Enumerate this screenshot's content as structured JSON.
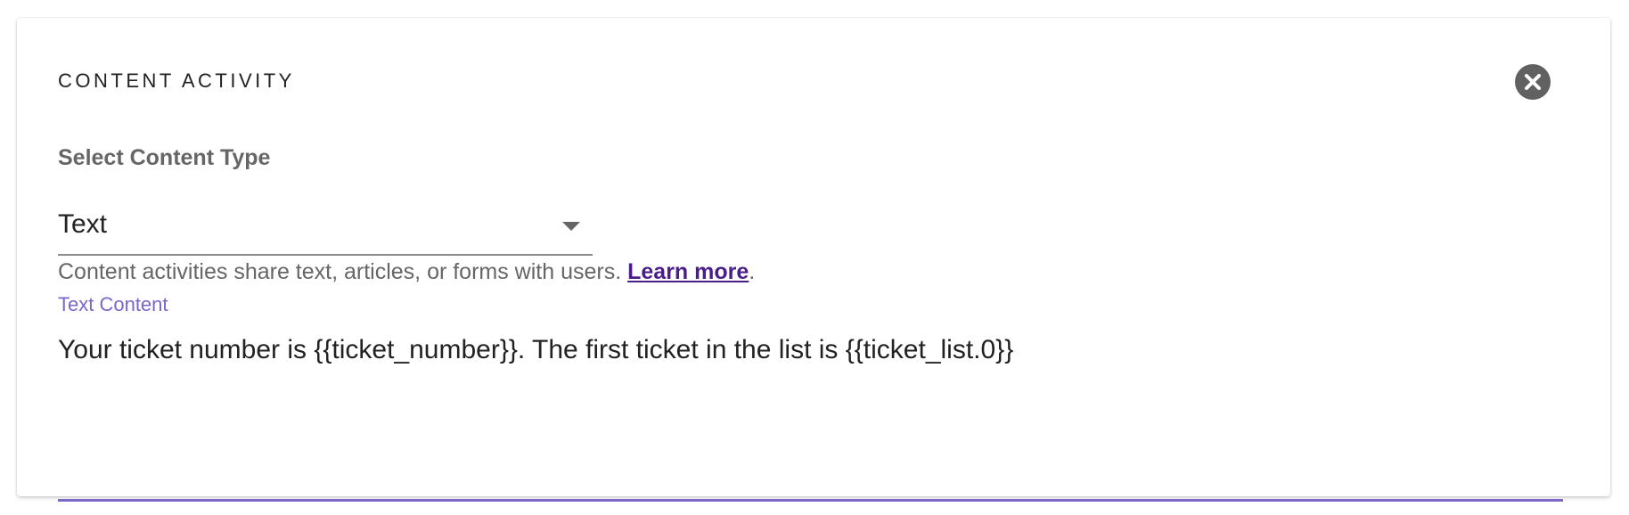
{
  "panel": {
    "title": "CONTENT ACTIVITY",
    "close_icon": "close-circle-icon"
  },
  "content_type": {
    "label": "Select Content Type",
    "selected_value": "Text",
    "helper_text": "Content activities share text, articles, or forms with users.",
    "learn_more_label": "Learn more",
    "helper_suffix": "."
  },
  "text_content": {
    "label": "Text Content",
    "value": "Your ticket number is {{ticket_number}}. The first ticket in the list is {{ticket_list.0}}"
  },
  "colors": {
    "accent": "#7b67c9",
    "link": "#4a1e8a",
    "close_button": "#616161"
  }
}
